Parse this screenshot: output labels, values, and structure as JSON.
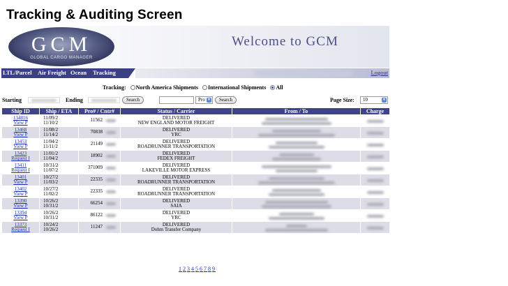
{
  "slide_title": "Tracking & Auditing Screen",
  "banner": {
    "logo_letters": "GCM",
    "logo_subtitle": "GLOBAL CARGO MANAGER",
    "welcome": "Welcome to GCM"
  },
  "nav": {
    "items": [
      "LTL/Parcel",
      "Air Freight",
      "Ocean",
      "Tracking"
    ],
    "logout": "Logout"
  },
  "tracking": {
    "label": "Tracking:",
    "options": [
      "North America Shipments",
      "International Shipments",
      "All"
    ],
    "selected": "All"
  },
  "search": {
    "starting_label": "Starting",
    "ending_label": "Ending",
    "search_button": "Search",
    "pro_select": "Pro",
    "search_button_2": "Search",
    "page_size_label": "Page Size:",
    "page_size_value": "10"
  },
  "table": {
    "headers": [
      "Ship ID",
      "Ship / ETA",
      "Pro# / Cntr#",
      "Status / Carrier",
      "From / To",
      "Charge"
    ],
    "rows": [
      {
        "id": "134816",
        "action": "View P",
        "date1": "11/09/2",
        "date2": "11/10/2",
        "pro": "11562",
        "status": "DELIVERED",
        "carrier": "NEW ENGLAND MOTOR FREIGHT"
      },
      {
        "id": "13468",
        "action": "View P",
        "date1": "11/08/2",
        "date2": "11/14/2",
        "pro": "70838",
        "status": "DELIVERED",
        "carrier": "YRC"
      },
      {
        "id": "13453",
        "action": "View P",
        "date1": "11/04/2",
        "date2": "11/11/2",
        "pro": "21149",
        "status": "DELIVERED",
        "carrier": "ROADRUNNER TRANSPORTATION"
      },
      {
        "id": "13423",
        "action": "Request I",
        "date1": "11/01/2",
        "date2": "11/04/2",
        "pro": "18902",
        "status": "DELIVERED",
        "carrier": "FEDEX FREIGHT"
      },
      {
        "id": "13411",
        "action": "Request I",
        "date1": "10/31/2",
        "date2": "11/07/2",
        "pro": "371009",
        "status": "DELIVERED",
        "carrier": "LAKEVILLE MOTOR EXPRESS"
      },
      {
        "id": "13401",
        "action": "View P",
        "date1": "10/27/2",
        "date2": "11/03/2",
        "pro": "22335",
        "status": "DELIVERED",
        "carrier": "ROADRUNNER TRANSPORTATION"
      },
      {
        "id": "13402",
        "action": "View P",
        "date1": "10/27/2",
        "date2": "11/02/2",
        "pro": "22335",
        "status": "DELIVERED",
        "carrier": "ROADRUNNER TRANSPORTATION"
      },
      {
        "id": "13390",
        "action": "View P",
        "date1": "10/26/2",
        "date2": "10/31/2",
        "pro": "66254",
        "status": "DELIVERED",
        "carrier": "SAIA"
      },
      {
        "id": "13394",
        "action": "View P",
        "date1": "10/26/2",
        "date2": "10/31/2",
        "pro": "86122",
        "status": "DELIVERED",
        "carrier": "YRC"
      },
      {
        "id": "13373",
        "action": "Request I",
        "date1": "10/24/2",
        "date2": "10/26/2",
        "pro": "11247",
        "status": "DELIVERED",
        "carrier": "Dohm Transfer Company"
      }
    ]
  },
  "pagination": [
    "1",
    "2",
    "3",
    "4",
    "5",
    "6",
    "7",
    "8",
    "9"
  ],
  "colors": {
    "header_blue": "#3f438f",
    "nav_blue": "#3a3f86",
    "welcome_text": "#4b4f86",
    "link_blue": "#1a2fb0",
    "row_alt": "#dcdde6"
  }
}
